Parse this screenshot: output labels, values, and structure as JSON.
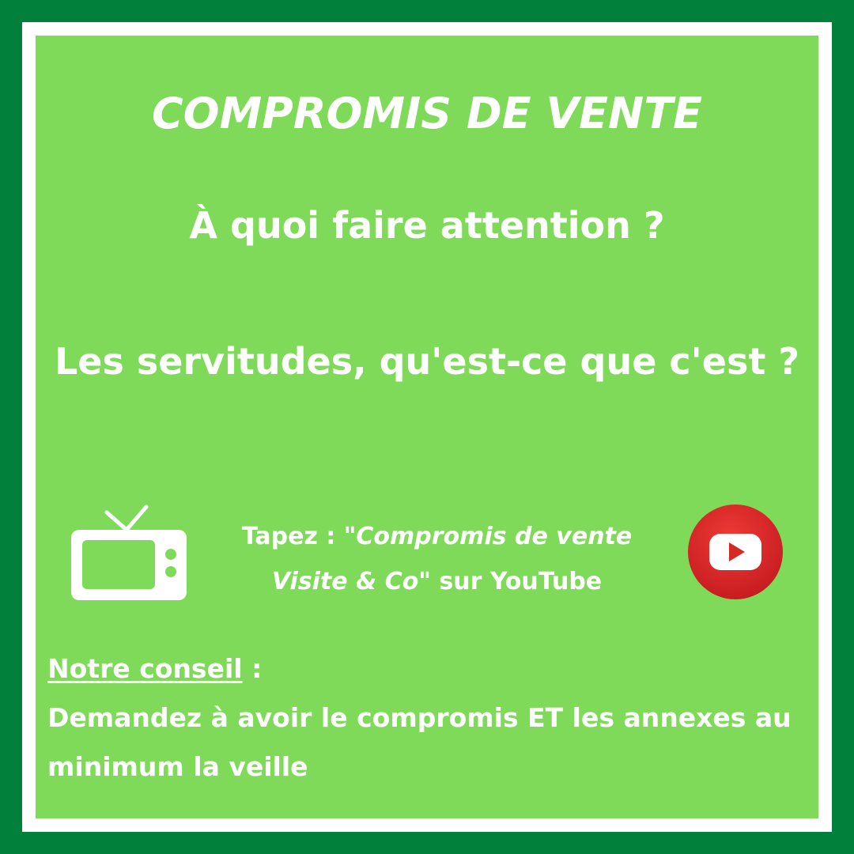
{
  "colors": {
    "outer_border": "#00803a",
    "inner_border": "#ffffff",
    "panel": "#80da5a",
    "text": "#ffffff",
    "youtube_red": "#e0322f"
  },
  "title": "COMPROMIS DE VENTE",
  "question_1": "À quoi faire attention ?",
  "question_2": "Les servitudes, qu'est-ce que c'est ?",
  "youtube_prompt": {
    "prefix": "Tapez : ",
    "quoted_line1": "\"Compromis de vente",
    "quoted_line2": "Visite & Co\"",
    "suffix": " sur YouTube"
  },
  "icons": {
    "left": "tv-icon",
    "right": "youtube-icon"
  },
  "advice": {
    "label": "Notre conseil",
    "separator": " :",
    "text": "Demandez à avoir le compromis ET les annexes au minimum la veille"
  }
}
